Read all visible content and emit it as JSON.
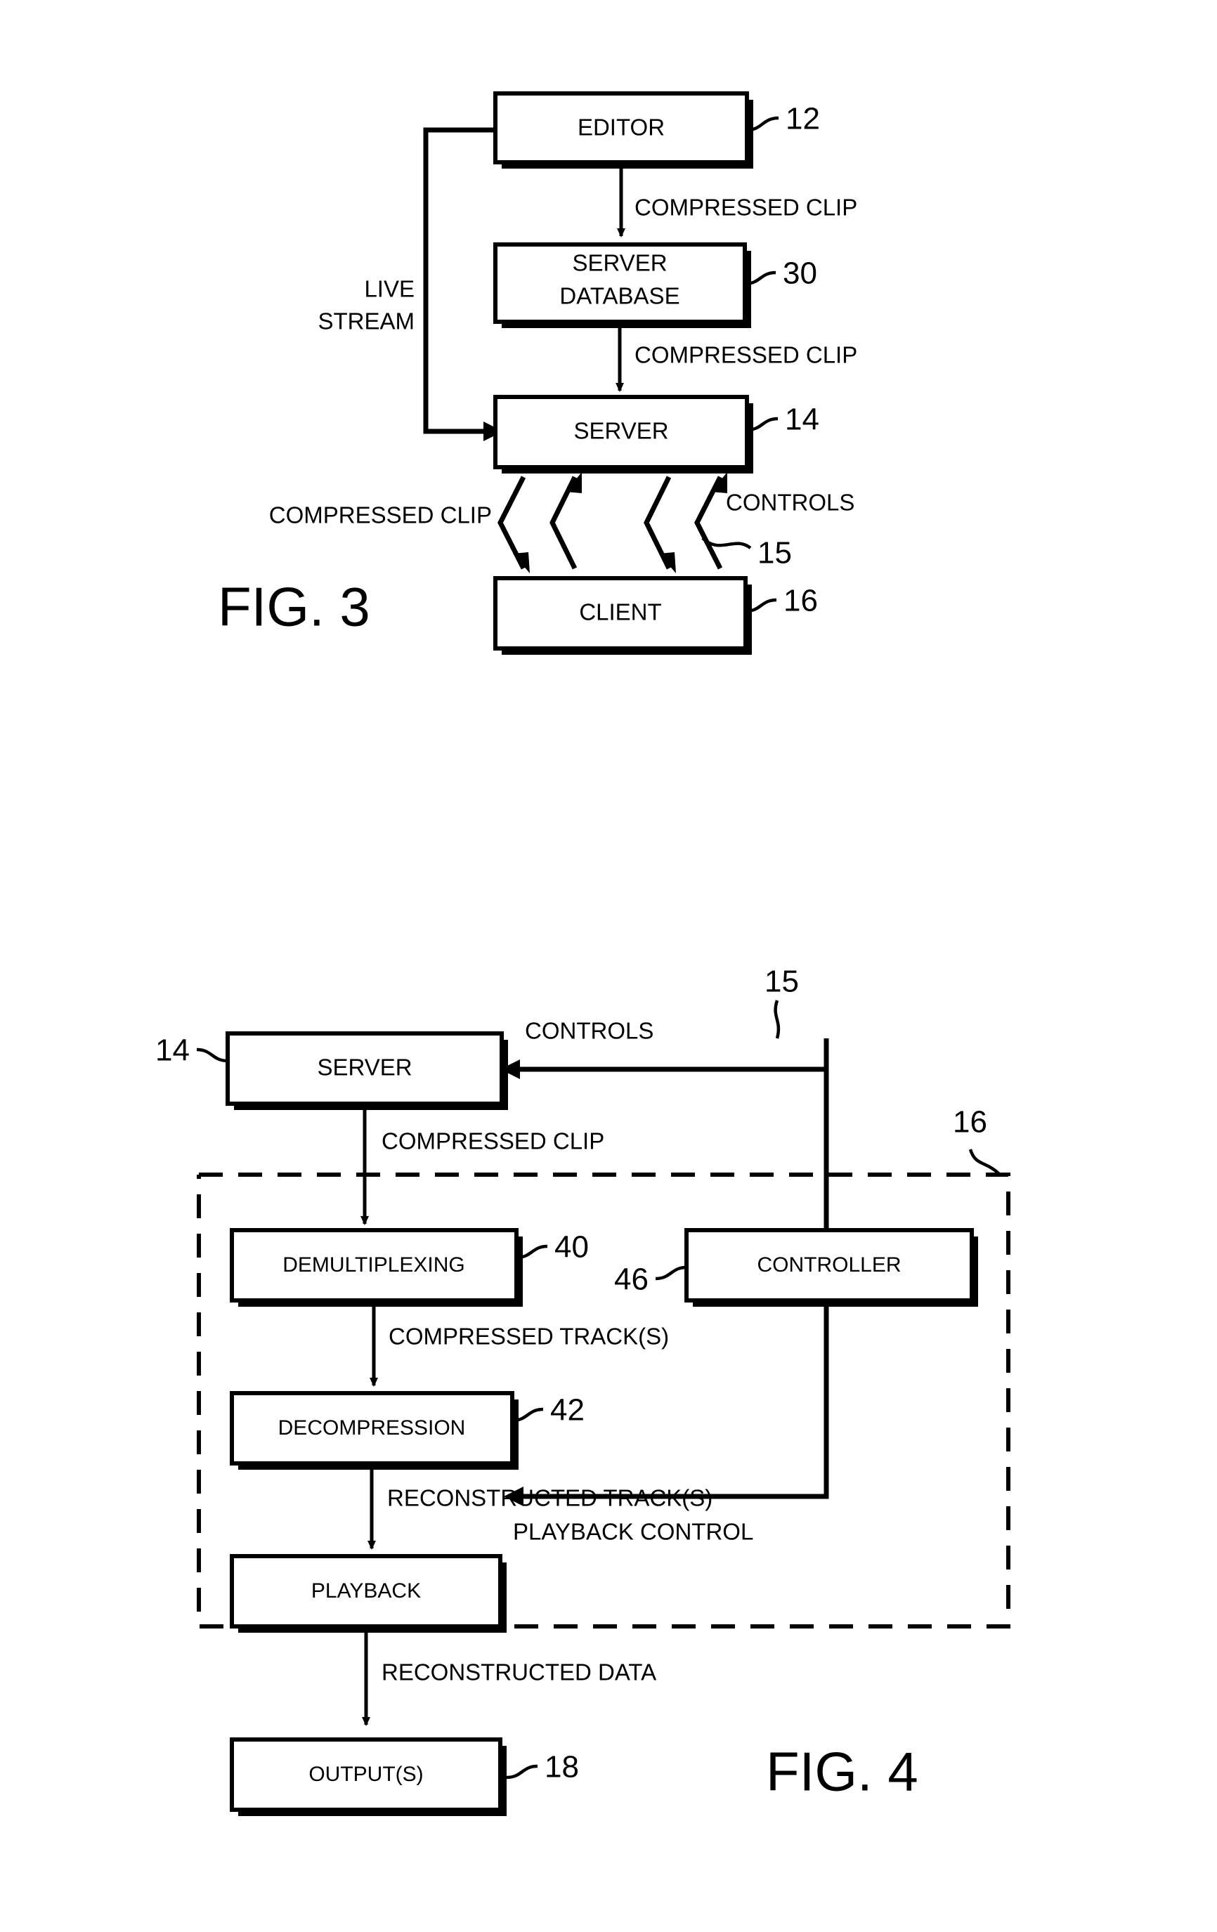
{
  "figures": [
    {
      "caption": "FIG. 3",
      "boxes": [
        {
          "id": "editor",
          "label": "EDITOR",
          "ref": "12"
        },
        {
          "id": "server_database",
          "label_line1": "SERVER",
          "label_line2": "DATABASE",
          "ref": "30"
        },
        {
          "id": "server",
          "label": "SERVER",
          "ref": "14"
        },
        {
          "id": "client",
          "label": "CLIENT",
          "ref": "16"
        }
      ],
      "flow_labels": [
        {
          "id": "editor_to_db",
          "text": "COMPRESSED CLIP"
        },
        {
          "id": "live_stream_line1",
          "text": "LIVE"
        },
        {
          "id": "live_stream_line2",
          "text": "STREAM"
        },
        {
          "id": "db_to_server",
          "text": "COMPRESSED CLIP"
        },
        {
          "id": "server_to_client",
          "text": "COMPRESSED CLIP"
        },
        {
          "id": "client_to_server",
          "text": "CONTROLS"
        }
      ],
      "extra_refs": [
        {
          "id": "controls_link",
          "text": "15"
        }
      ]
    },
    {
      "caption": "FIG. 4",
      "boxes": [
        {
          "id": "server",
          "label": "SERVER",
          "ref": "14"
        },
        {
          "id": "demultiplexing",
          "label": "DEMULTIPLEXING",
          "ref": "40"
        },
        {
          "id": "controller",
          "label": "CONTROLLER",
          "ref": "46"
        },
        {
          "id": "decompression",
          "label": "DECOMPRESSION",
          "ref": "42"
        },
        {
          "id": "playback",
          "label": "PLAYBACK",
          "ref": ""
        },
        {
          "id": "outputs",
          "label": "OUTPUT(S)",
          "ref": "18"
        }
      ],
      "flow_labels": [
        {
          "id": "controls",
          "text": "CONTROLS"
        },
        {
          "id": "compressed_clip",
          "text": "COMPRESSED CLIP"
        },
        {
          "id": "compressed_tracks",
          "text": "COMPRESSED TRACK(S)"
        },
        {
          "id": "reconstructed_tracks",
          "text": "RECONSTRUCTED TRACK(S)"
        },
        {
          "id": "playback_control",
          "text": "PLAYBACK CONTROL"
        },
        {
          "id": "reconstructed_data",
          "text": "RECONSTRUCTED DATA"
        }
      ],
      "extra_refs": [
        {
          "id": "controls_bus",
          "text": "15"
        },
        {
          "id": "client_region",
          "text": "16"
        }
      ]
    }
  ],
  "colors": {
    "ink": "#000000",
    "paper": "#ffffff"
  }
}
